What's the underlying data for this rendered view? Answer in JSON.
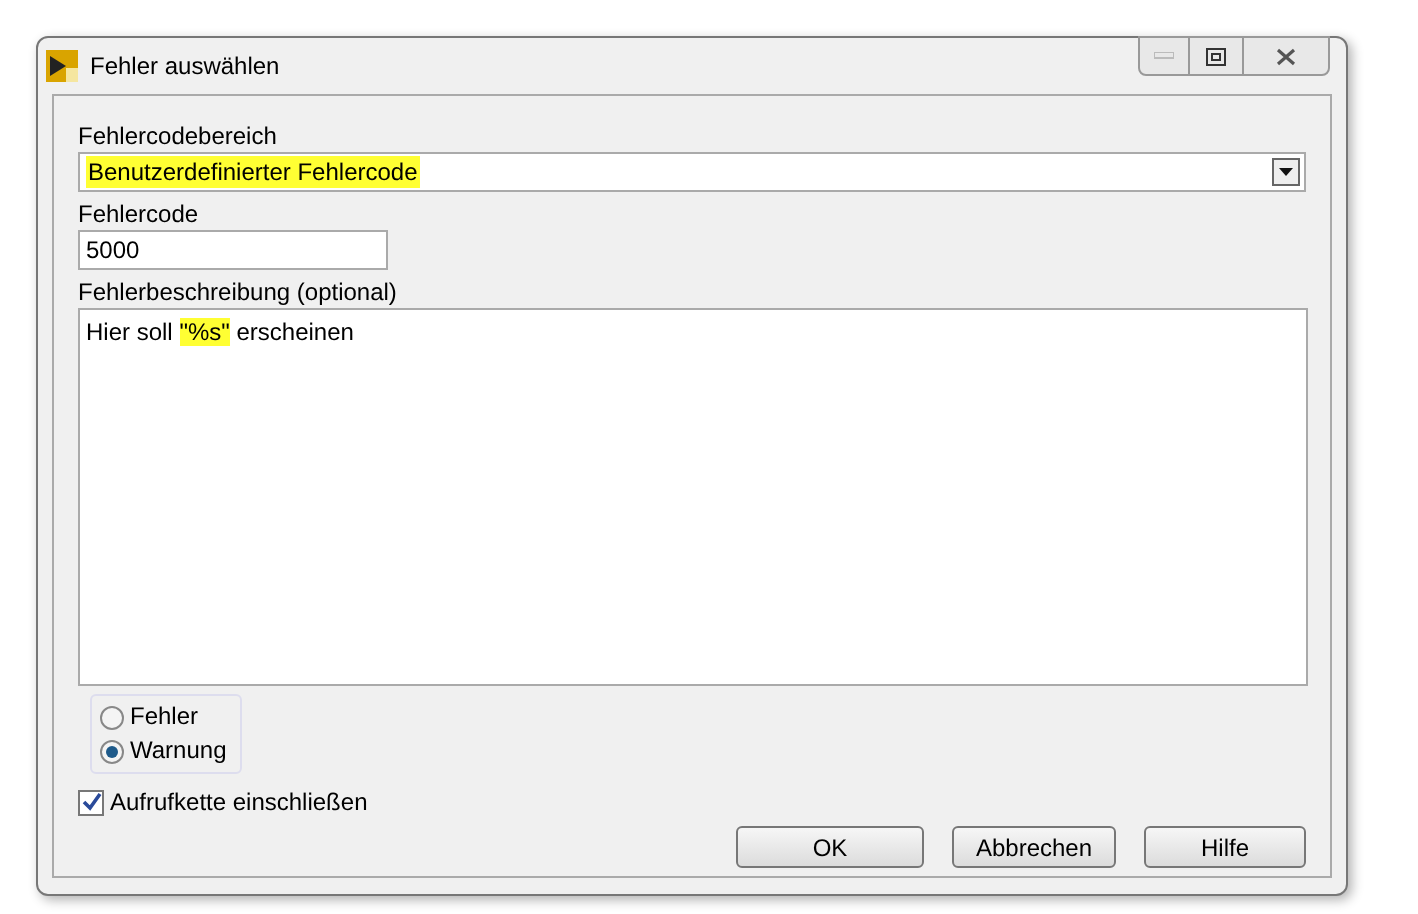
{
  "window": {
    "title": "Fehler auswählen"
  },
  "range": {
    "label": "Fehlercodebereich",
    "value": "Benutzerdefinierter Fehlercode",
    "highlighted": true
  },
  "code": {
    "label": "Fehlercode",
    "value": "5000"
  },
  "description": {
    "label": "Fehlerbeschreibung (optional)",
    "segments": [
      {
        "text": "Hier soll ",
        "highlighted": false
      },
      {
        "text": "\"%s\"",
        "highlighted": true
      },
      {
        "text": " erscheinen",
        "highlighted": false
      }
    ]
  },
  "severity": [
    {
      "label": "Fehler",
      "selected": false
    },
    {
      "label": "Warnung",
      "selected": true
    }
  ],
  "call_chain": {
    "label": "Aufrufkette einschließen",
    "checked": true
  },
  "buttons": [
    "OK",
    "Abbrechen",
    "Hilfe"
  ]
}
